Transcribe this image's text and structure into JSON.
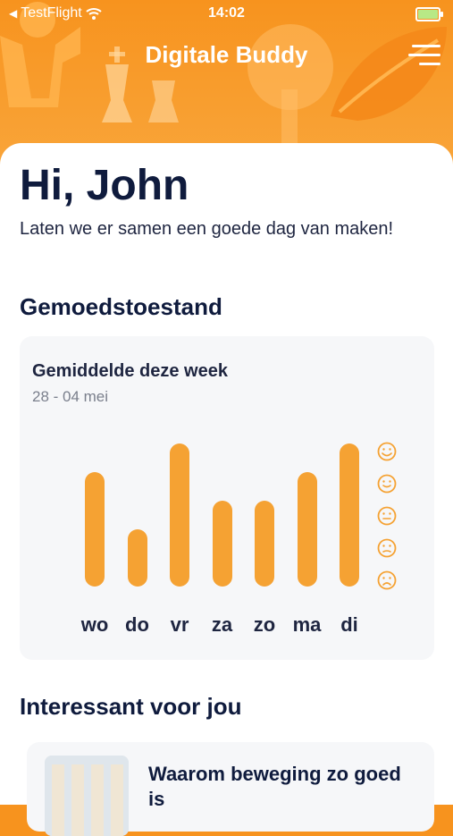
{
  "status_bar": {
    "back_app": "TestFlight",
    "time": "14:02"
  },
  "header": {
    "title": "Digitale Buddy",
    "menu_icon": "hamburger-icon"
  },
  "greeting": {
    "title": "Hi, John",
    "subtitle": "Laten we er samen een goede dag van maken!"
  },
  "mood": {
    "section_title": "Gemoedstoestand",
    "card_title": "Gemiddelde deze week",
    "date_range": "28 - 04 mei",
    "scale_icons": [
      "very-happy-face-icon",
      "happy-face-icon",
      "neutral-face-icon",
      "slightly-sad-face-icon",
      "sad-face-icon"
    ],
    "days": [
      {
        "label": "wo",
        "level": 4
      },
      {
        "label": "do",
        "level": 2
      },
      {
        "label": "vr",
        "level": 5
      },
      {
        "label": "za",
        "level": 3
      },
      {
        "label": "zo",
        "level": 3
      },
      {
        "label": "ma",
        "level": 4
      },
      {
        "label": "di",
        "level": 5
      }
    ],
    "bar_color": "#f5a233"
  },
  "recommended": {
    "section_title": "Interessant voor jou",
    "item_title": "Waarom beweging zo goed is"
  },
  "colors": {
    "brand_orange": "#f7931e",
    "text_dark": "#0f1b3d"
  }
}
